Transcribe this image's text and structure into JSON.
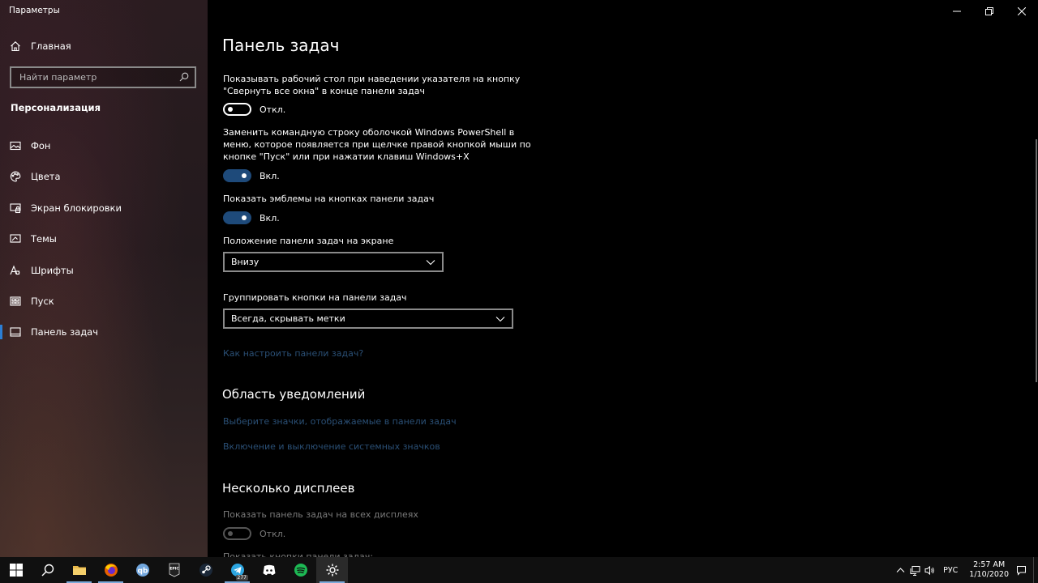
{
  "window": {
    "title": "Параметры"
  },
  "sidebar": {
    "home_label": "Главная",
    "search_placeholder": "Найти параметр",
    "section_title": "Персонализация",
    "items": [
      {
        "label": "Фон",
        "icon": "image-icon"
      },
      {
        "label": "Цвета",
        "icon": "palette-icon"
      },
      {
        "label": "Экран блокировки",
        "icon": "lock-screen-icon"
      },
      {
        "label": "Темы",
        "icon": "themes-icon"
      },
      {
        "label": "Шрифты",
        "icon": "font-icon"
      },
      {
        "label": "Пуск",
        "icon": "start-icon"
      },
      {
        "label": "Панель задач",
        "icon": "taskbar-icon",
        "active": true
      }
    ]
  },
  "main": {
    "title": "Панель задач",
    "peek": {
      "label_line1": "Показывать рабочий стол при наведении указателя на кнопку",
      "label_line2": "\"Свернуть все окна\" в конце панели задач",
      "state": "Откл."
    },
    "powershell": {
      "label_line1": "Заменить командную строку оболочкой Windows PowerShell в",
      "label_line2": "меню, которое появляется при щелчке правой кнопкой мыши по",
      "label_line3": "кнопке \"Пуск\" или при нажатии клавиш Windows+X",
      "state": "Вкл."
    },
    "badges": {
      "label": "Показать эмблемы на кнопках панели задач",
      "state": "Вкл."
    },
    "position": {
      "label": "Положение панели задач на экране",
      "value": "Внизу"
    },
    "combine": {
      "label": "Группировать кнопки на панели задач",
      "value": "Всегда, скрывать метки"
    },
    "customize_link": "Как настроить панели задач?",
    "notification_area": {
      "heading": "Область уведомлений",
      "link1": "Выберите значки, отображаемые в панели задач",
      "link2": "Включение и выключение системных значков"
    },
    "multiple_displays": {
      "heading": "Несколько дисплеев",
      "show_label": "Показать панель задач на всех дисплеях",
      "show_state": "Откл.",
      "buttons_label": "Показать кнопки панели задач:"
    }
  },
  "taskbar": {
    "apps": [
      {
        "name": "start-button",
        "icon": "windows-logo-icon"
      },
      {
        "name": "search-button",
        "icon": "search-icon"
      },
      {
        "name": "file-explorer",
        "icon": "folder-icon"
      },
      {
        "name": "firefox",
        "icon": "firefox-icon"
      },
      {
        "name": "qbittorrent",
        "icon": "qbittorrent-icon"
      },
      {
        "name": "epic-games",
        "icon": "epic-games-icon"
      },
      {
        "name": "steam",
        "icon": "steam-icon"
      },
      {
        "name": "telegram",
        "icon": "telegram-icon",
        "badge": "277"
      },
      {
        "name": "discord",
        "icon": "discord-icon"
      },
      {
        "name": "spotify",
        "icon": "spotify-icon"
      },
      {
        "name": "settings",
        "icon": "gear-icon"
      }
    ],
    "epic_text": "EPIC",
    "telegram_badge": "277",
    "language": "РУС",
    "time": "2:57 AM",
    "date": "1/10/2020"
  },
  "colors": {
    "accent": "#2b7fd6",
    "toggle_on": "#1e4a7a",
    "link": "#2a4f75"
  }
}
